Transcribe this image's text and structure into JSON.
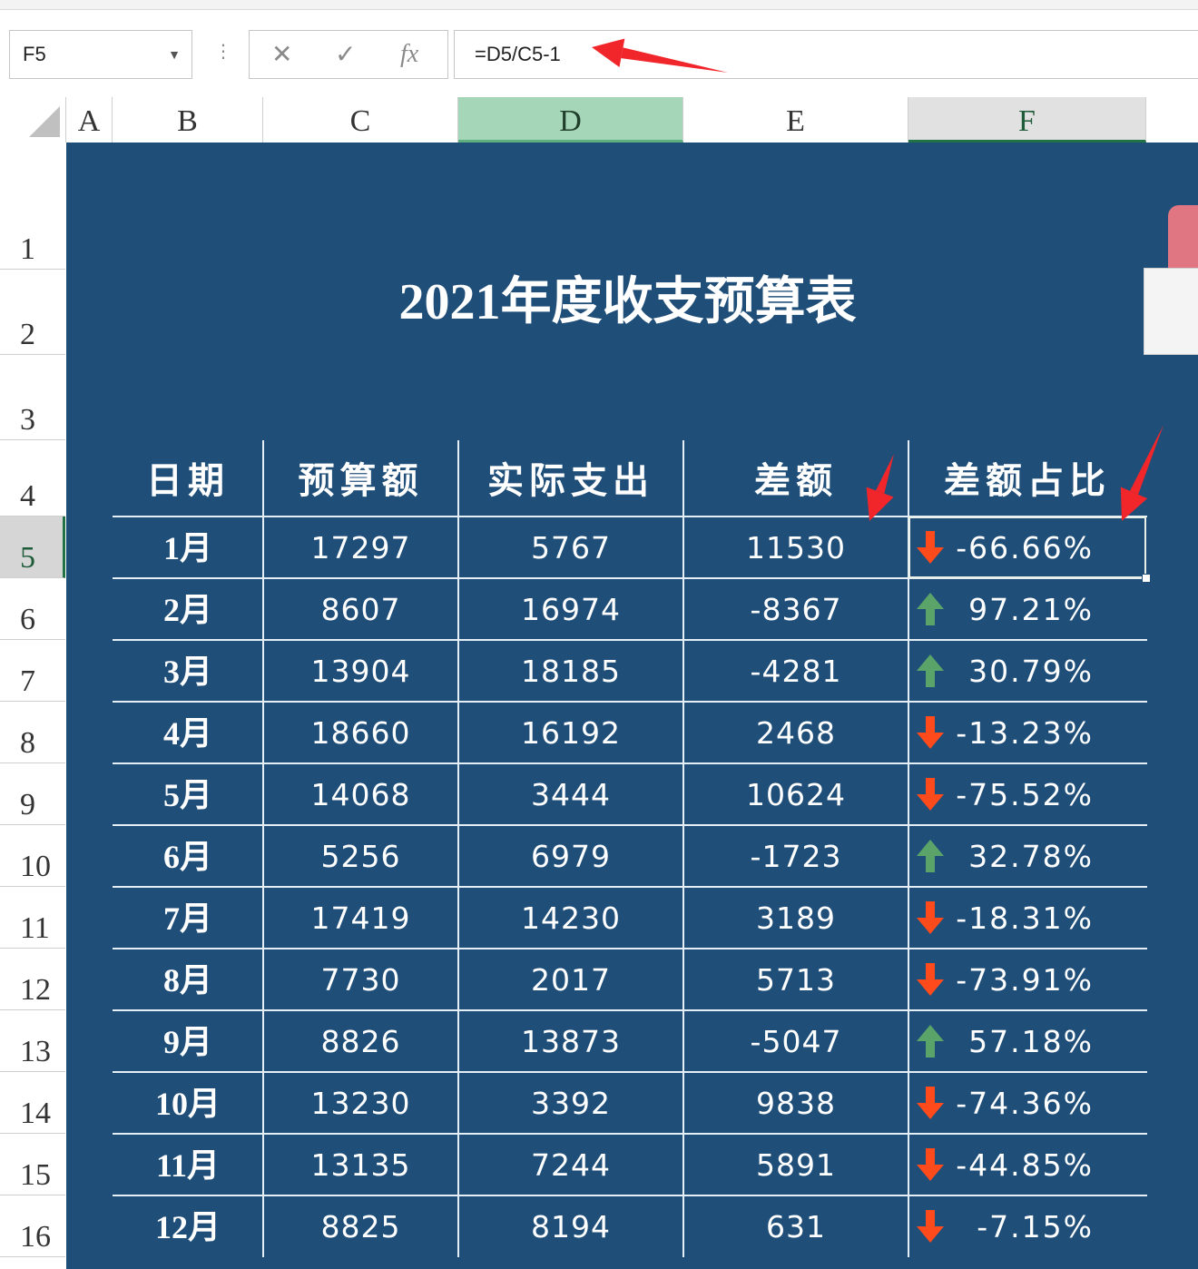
{
  "formula_bar": {
    "name_box": "F5",
    "formula": "=D5/C5-1",
    "cancel_icon": "✕",
    "enter_icon": "✓",
    "fx_label": "fx",
    "more_icon": "⋮"
  },
  "columns": [
    "A",
    "B",
    "C",
    "D",
    "E",
    "F"
  ],
  "rows": [
    "1",
    "2",
    "3",
    "4",
    "5",
    "6",
    "7",
    "8",
    "9",
    "10",
    "11",
    "12",
    "13",
    "14",
    "15",
    "16"
  ],
  "selected_column": "D",
  "active_cell": "F5",
  "sheet": {
    "title": "2021年度收支预算表",
    "background_color": "#1f4e79",
    "headers": [
      "日期",
      "预算额",
      "实际支出",
      "差额",
      "差额占比"
    ],
    "table": [
      {
        "month": "1月",
        "budget": "17297",
        "actual": "5767",
        "diff": "11530",
        "pct": "-66.66%",
        "trend": "down"
      },
      {
        "month": "2月",
        "budget": "8607",
        "actual": "16974",
        "diff": "-8367",
        "pct": "97.21%",
        "trend": "up"
      },
      {
        "month": "3月",
        "budget": "13904",
        "actual": "18185",
        "diff": "-4281",
        "pct": "30.79%",
        "trend": "up"
      },
      {
        "month": "4月",
        "budget": "18660",
        "actual": "16192",
        "diff": "2468",
        "pct": "-13.23%",
        "trend": "down"
      },
      {
        "month": "5月",
        "budget": "14068",
        "actual": "3444",
        "diff": "10624",
        "pct": "-75.52%",
        "trend": "down"
      },
      {
        "month": "6月",
        "budget": "5256",
        "actual": "6979",
        "diff": "-1723",
        "pct": "32.78%",
        "trend": "up"
      },
      {
        "month": "7月",
        "budget": "17419",
        "actual": "14230",
        "diff": "3189",
        "pct": "-18.31%",
        "trend": "down"
      },
      {
        "month": "8月",
        "budget": "7730",
        "actual": "2017",
        "diff": "5713",
        "pct": "-73.91%",
        "trend": "down"
      },
      {
        "month": "9月",
        "budget": "8826",
        "actual": "13873",
        "diff": "-5047",
        "pct": "57.18%",
        "trend": "up"
      },
      {
        "month": "10月",
        "budget": "13230",
        "actual": "3392",
        "diff": "9838",
        "pct": "-74.36%",
        "trend": "down"
      },
      {
        "month": "11月",
        "budget": "13135",
        "actual": "7244",
        "diff": "5891",
        "pct": "-44.85%",
        "trend": "down"
      },
      {
        "month": "12月",
        "budget": "8825",
        "actual": "8194",
        "diff": "631",
        "pct": "-7.15%",
        "trend": "down"
      }
    ]
  },
  "colors": {
    "up_arrow": "#5aa469",
    "down_arrow": "#ff4a1c",
    "annotation_arrow": "#f0262b"
  }
}
